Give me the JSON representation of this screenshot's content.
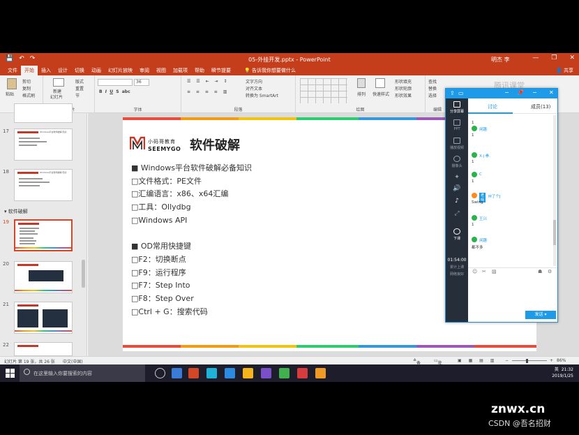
{
  "titlebar": {
    "doc_title": "05-外挂开发.pptx - PowerPoint",
    "user": "明杰 李",
    "min": "—",
    "max": "❐",
    "close": "✕",
    "qat_save": "💾",
    "qat_undo": "↶",
    "qat_redo": "↷"
  },
  "menu": {
    "tabs": [
      "文件",
      "开始",
      "插入",
      "设计",
      "切换",
      "动画",
      "幻灯片放映",
      "审阅",
      "视图",
      "加载项",
      "帮助",
      "瞬节提要"
    ],
    "tellme": "告诉我你想要做什么",
    "share": "共享"
  },
  "ribbon": {
    "paste": "粘贴",
    "cut": "剪切",
    "copy": "复制",
    "format_painter": "格式刷",
    "clipboard": "剪贴板",
    "new_slide_1": "新建",
    "new_slide_2": "幻灯片",
    "layout": "版式",
    "reset": "重置",
    "section": "节",
    "slides_group": "幻灯片",
    "font_size": "36",
    "font_group": "字体",
    "text_direction": "文字方向",
    "align_text": "对齐文本",
    "smartart": "转换为 SmartArt",
    "paragraph_group": "段落",
    "arrange": "排列",
    "quick_styles": "快速样式",
    "shape_fill": "形状填充",
    "shape_outline": "形状轮廓",
    "shape_effects": "形状效果",
    "drawing_group": "绘图",
    "find": "查找",
    "replace": "替换",
    "select": "选择",
    "editing_group": "编辑"
  },
  "slides_panel": {
    "numbers": [
      "17",
      "18",
      "19",
      "20",
      "21",
      "22"
    ],
    "section": "软件破解",
    "title_17": "Windows平台软件破解-知识",
    "title_18": "Windows平台软件破解-知识"
  },
  "slide": {
    "logo_cn": "小码哥教育",
    "logo_en": "SEEMYGO",
    "title": "软件破解",
    "bullets": [
      "■ Windows平台软件破解必备知识",
      "□文件格式：PE文件",
      "□汇编语言：x86、x64汇编",
      "□工具：Ollydbg",
      "□Windows API"
    ],
    "bullets2": [
      "■ OD常用快捷键",
      "□F2：切换断点",
      "□F9：运行程序",
      "□F7：Step Into",
      "□F8：Step Over",
      "□Ctrl + G：搜索代码"
    ]
  },
  "chat": {
    "tab_discuss": "讨论",
    "tab_members": "成员(13)",
    "side_items": [
      "分享屏幕",
      "PPT",
      "播放视频",
      "摄像头",
      "",
      "",
      "",
      ""
    ],
    "hangup": "下课",
    "timer": "01:54:00",
    "timer_note": "累计上课",
    "net": "网络良好",
    "messages": [
      {
        "name": "",
        "text": "1"
      },
      {
        "name": "闲趣",
        "text": "1"
      },
      {
        "name": "X-j 拳.",
        "text": "1"
      },
      {
        "name": "C",
        "text": "1"
      },
      {
        "badge": "老师",
        "name": "M了个J",
        "text": "Swing"
      },
      {
        "name": "王兴",
        "text": "1"
      },
      {
        "name": "闲趣",
        "text": "都不多"
      }
    ],
    "send": "发送"
  },
  "statusbar": {
    "slide_info": "幻灯片 第 19 张，共 26 张",
    "lang": "中文(中国)",
    "notes": "备注",
    "comments": "批注",
    "zoom": "86%"
  },
  "taskbar": {
    "search_placeholder": "在这里输入你要搜索的内容",
    "time": "21:32",
    "date": "2019/1/25",
    "ime": "英"
  },
  "overlay": {
    "watermark": "腾讯课堂",
    "site": "znwx.cn",
    "csdn": "CSDN @吾名招财"
  }
}
